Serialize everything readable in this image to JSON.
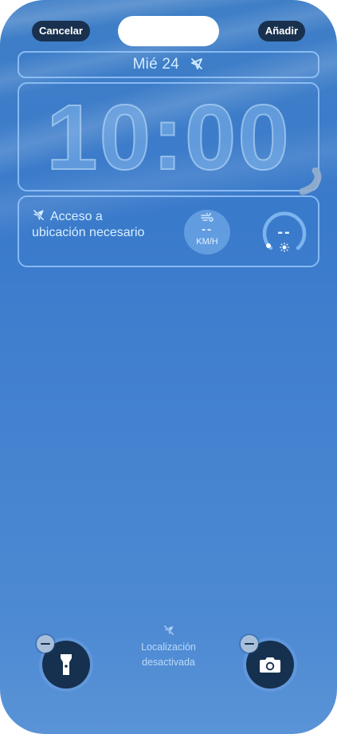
{
  "top_bar": {
    "cancel_label": "Cancelar",
    "add_label": "Añadir"
  },
  "date": {
    "text": "Mié 24",
    "icon": "location-off-icon"
  },
  "clock": {
    "time": "10:00"
  },
  "widgets": {
    "location": {
      "text": "Acceso a ubicación necesario",
      "icon": "location-off-icon"
    },
    "wind": {
      "value": "--",
      "unit": "KM/H",
      "icon": "wind-icon"
    },
    "uv": {
      "value": "--",
      "icon": "sun-icon"
    }
  },
  "bottom": {
    "location_status": "Localización desactivada",
    "left_action": "flashlight-icon",
    "right_action": "camera-icon"
  },
  "colors": {
    "background": "#4583d0",
    "button_dark": "#16304f",
    "frame": "#a0cdff"
  }
}
